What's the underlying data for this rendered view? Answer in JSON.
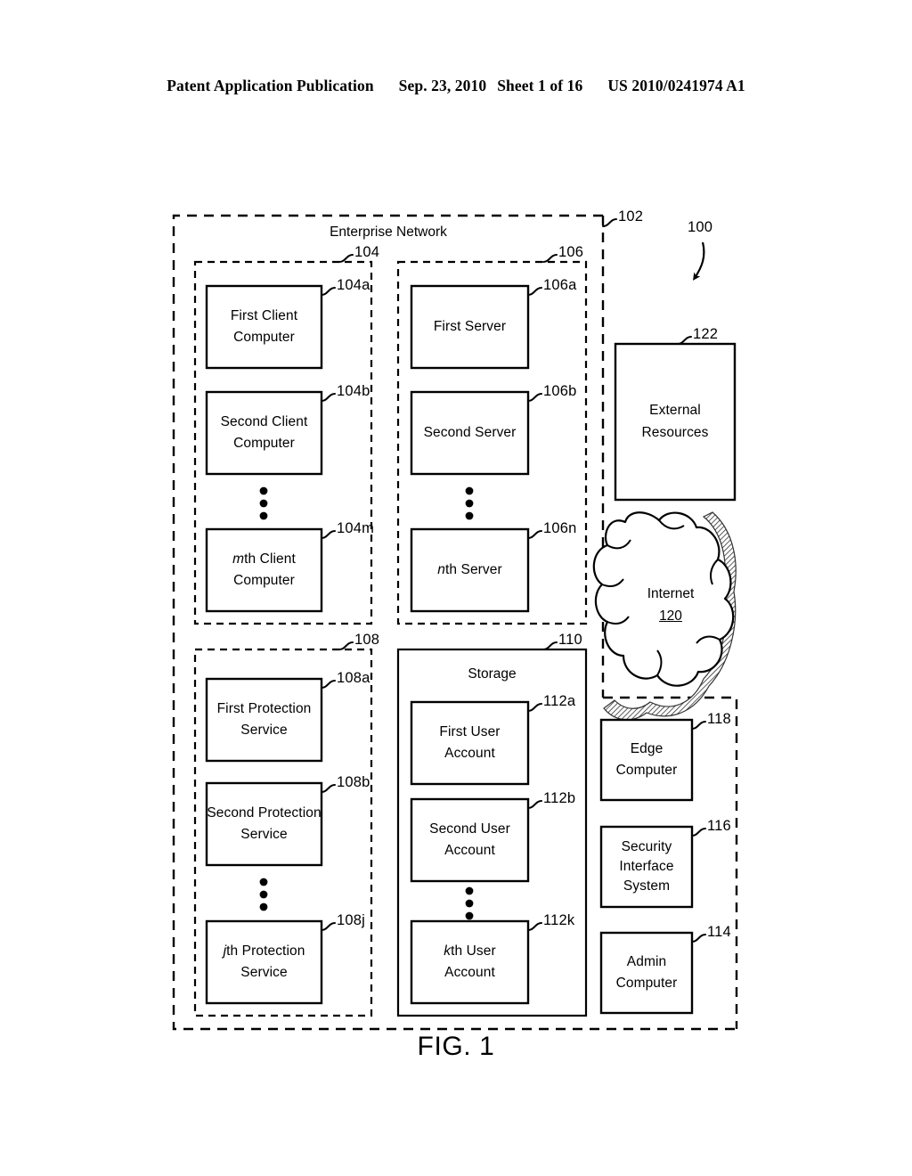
{
  "header": {
    "publication": "Patent Application Publication",
    "date": "Sep. 23, 2010",
    "sheet": "Sheet 1 of 16",
    "patent_number": "US 2010/0241974 A1"
  },
  "figure": {
    "caption": "FIG. 1",
    "system_ref": "100",
    "enterprise_network": {
      "title": "Enterprise Network",
      "ref": "102"
    },
    "groups": {
      "clients": {
        "ref": "104"
      },
      "servers": {
        "ref": "106"
      },
      "protection_services": {
        "ref": "108"
      },
      "storage": {
        "title": "Storage",
        "ref": "110"
      }
    },
    "clients": [
      {
        "ref": "104a",
        "line1": "First Client",
        "line2": "Computer",
        "italic_prefix": ""
      },
      {
        "ref": "104b",
        "line1": "Second Client",
        "line2": "Computer",
        "italic_prefix": ""
      },
      {
        "ref": "104m",
        "line1": "th Client",
        "line2": "Computer",
        "italic_prefix": "m"
      }
    ],
    "servers": [
      {
        "ref": "106a",
        "line1": "First Server",
        "line2": "",
        "italic_prefix": ""
      },
      {
        "ref": "106b",
        "line1": "Second Server",
        "line2": "",
        "italic_prefix": ""
      },
      {
        "ref": "106n",
        "line1": "th Server",
        "line2": "",
        "italic_prefix": "n"
      }
    ],
    "protection_services": [
      {
        "ref": "108a",
        "line1": "First Protection",
        "line2": "Service",
        "italic_prefix": ""
      },
      {
        "ref": "108b",
        "line1": "Second Protection",
        "line2": "Service",
        "italic_prefix": ""
      },
      {
        "ref": "108j",
        "line1": "th Protection",
        "line2": "Service",
        "italic_prefix": "j"
      }
    ],
    "user_accounts": [
      {
        "ref": "112a",
        "line1": "First User",
        "line2": "Account",
        "italic_prefix": ""
      },
      {
        "ref": "112b",
        "line1": "Second User",
        "line2": "Account",
        "italic_prefix": ""
      },
      {
        "ref": "112k",
        "line1": "th User",
        "line2": "Account",
        "italic_prefix": "k"
      }
    ],
    "external_resources": {
      "ref": "122",
      "line1": "External",
      "line2": "Resources"
    },
    "internet": {
      "label": "Internet",
      "ref": "120"
    },
    "edge_computer": {
      "ref": "118",
      "line1": "Edge",
      "line2": "Computer"
    },
    "security_interface_system": {
      "ref": "116",
      "line1": "Security",
      "line2": "Interface",
      "line3": "System"
    },
    "admin_computer": {
      "ref": "114",
      "line1": "Admin",
      "line2": "Computer"
    }
  }
}
